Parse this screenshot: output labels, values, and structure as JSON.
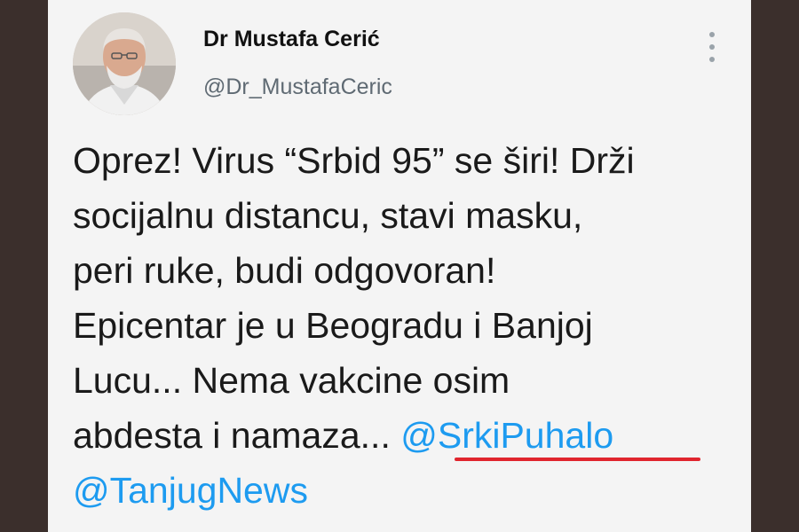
{
  "profile": {
    "display_name": "Dr Mustafa Cerić",
    "handle": "@Dr_MustafaCeric",
    "avatar_icon": "person-portrait"
  },
  "tweet": {
    "text_lines": [
      "Oprez! Virus “Srbid 95” se širi! Drži",
      "socijalnu distancu, stavi masku,",
      "peri ruke, budi odgovoran!",
      "Epicentar je u Beogradu i Banjoj",
      "Lucu... Nema vakcine osim",
      "abdesta i namaza... "
    ],
    "mention_1": "@SrkiPuhalo",
    "mention_2": "@TanjugNews"
  },
  "colors": {
    "link": "#1d9bf0",
    "highlight_underline": "#e0252e",
    "background_border": "#3b2f2c"
  },
  "menu": {
    "icon": "more-vertical-icon"
  }
}
